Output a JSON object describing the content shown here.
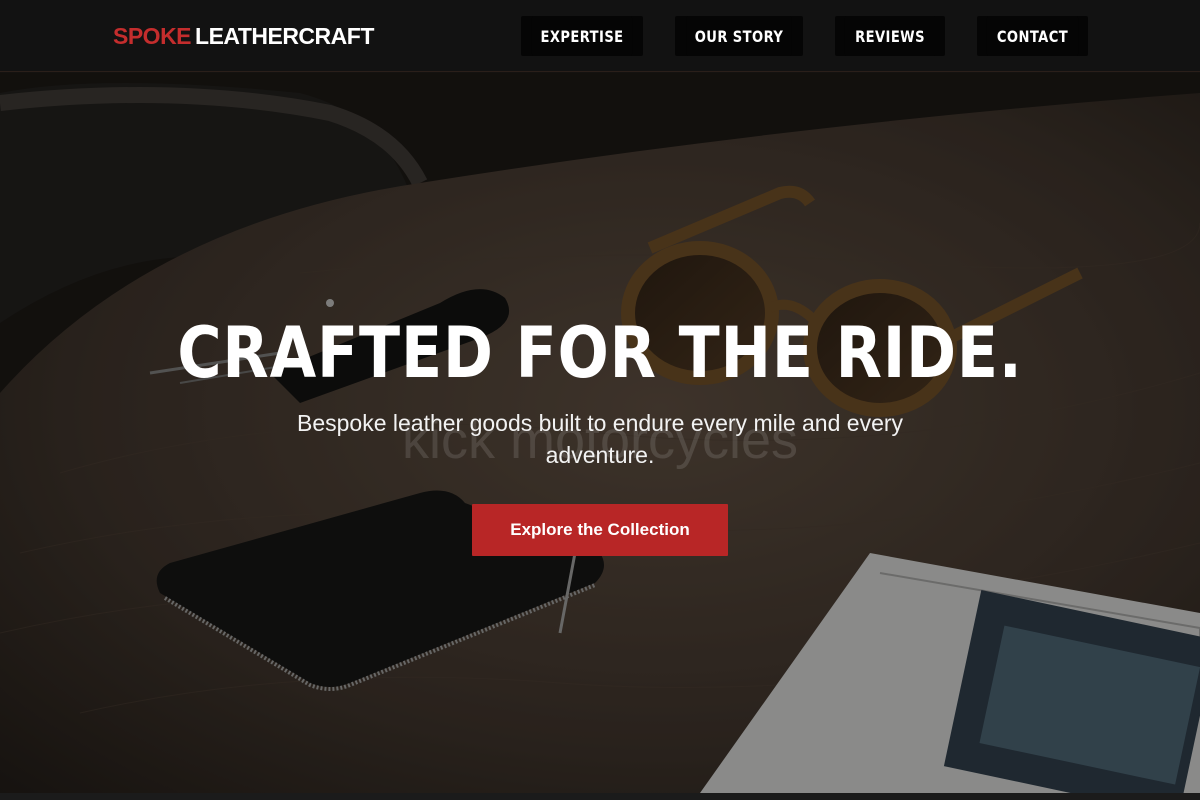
{
  "header": {
    "logo_part1": "SPOKE",
    "logo_part2": "LEATHERCRAFT",
    "nav": [
      "EXPERTISE",
      "OUR STORY",
      "REVIEWS",
      "CONTACT"
    ]
  },
  "hero": {
    "title": "CRAFTED FOR THE RIDE.",
    "subtitle": "Bespoke leather goods built to endure every mile and every adventure.",
    "watermark": "kick motorcycles",
    "cta_label": "Explore the Collection"
  },
  "colors": {
    "brand_red": "#c42d2d",
    "cta_red": "#b82626",
    "header_bg": "#121212"
  }
}
